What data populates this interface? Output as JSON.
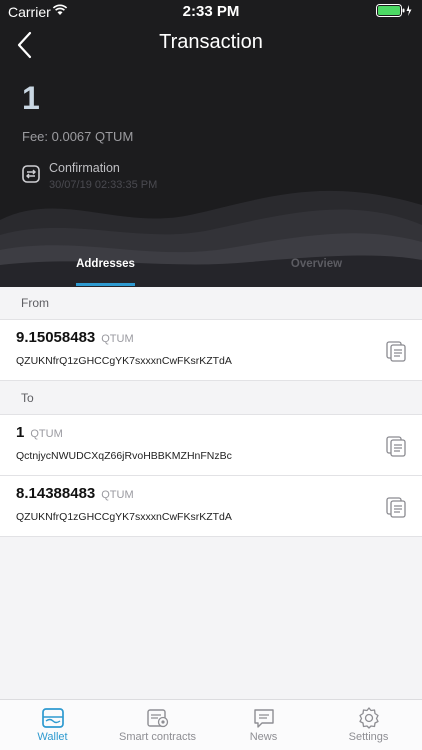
{
  "status_bar": {
    "carrier": "Carrier",
    "time": "2:33 PM"
  },
  "nav": {
    "title": "Transaction",
    "back_icon": "chevron-left-icon"
  },
  "transaction": {
    "amount": "1",
    "fee": "Fee: 0.0067 QTUM",
    "confirmation_label": "Confirmation",
    "date": "30/07/19 02:33:35 PM"
  },
  "tabs": [
    {
      "label": "Addresses",
      "active": true
    },
    {
      "label": "Overview",
      "active": false
    }
  ],
  "from": {
    "label": "From",
    "items": [
      {
        "amount": "9.15058483",
        "unit": "QTUM",
        "address": "QZUKNfrQ1zGHCCgYK7sxxxnCwFKsrKZTdA"
      }
    ]
  },
  "to": {
    "label": "To",
    "items": [
      {
        "amount": "1",
        "unit": "QTUM",
        "address": "QctnjycNWUDCXqZ66jRvoHBBKMZHnFNzBc"
      },
      {
        "amount": "8.14388483",
        "unit": "QTUM",
        "address": "QZUKNfrQ1zGHCCgYK7sxxxnCwFKsrKZTdA"
      }
    ]
  },
  "tabbar": [
    {
      "label": "Wallet",
      "icon": "wallet-icon",
      "active": true
    },
    {
      "label": "Smart contracts",
      "icon": "contracts-icon",
      "active": false
    },
    {
      "label": "News",
      "icon": "news-icon",
      "active": false
    },
    {
      "label": "Settings",
      "icon": "gear-icon",
      "active": false
    }
  ],
  "colors": {
    "accent": "#2e9ad0",
    "header_bg": "#1c1c1e",
    "body_bg": "#f4f4f6"
  }
}
